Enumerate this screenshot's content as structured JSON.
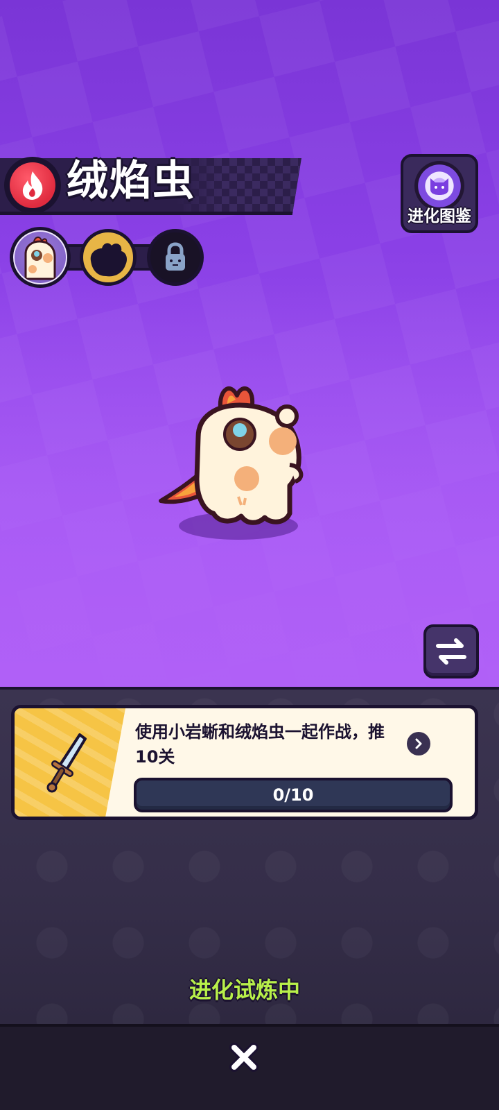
{
  "creature": {
    "name": "绒焰虫",
    "element_icon": "flame-icon",
    "element_color": "#e02b3f"
  },
  "evolution_guide": {
    "label": "进化图鉴",
    "icon": "cat-star-emblem-icon"
  },
  "evolution_stages": [
    {
      "state": "current",
      "icon": "creature-portrait-icon"
    },
    {
      "state": "silhouette",
      "icon": "creature-silhouette-icon"
    },
    {
      "state": "locked",
      "icon": "lock-icon"
    }
  ],
  "swap_button": {
    "icon": "swap-arrows-icon"
  },
  "quest": {
    "icon": "sword-icon",
    "description": "使用小岩蜥和绒焰虫一起作战，推10关",
    "progress_current": 0,
    "progress_total": 10,
    "progress_label": "0/10",
    "detail_icon": "chevron-right-icon"
  },
  "status": {
    "text": "进化试炼中",
    "color": "#b8f04a"
  },
  "footer": {
    "close_icon": "close-icon"
  }
}
